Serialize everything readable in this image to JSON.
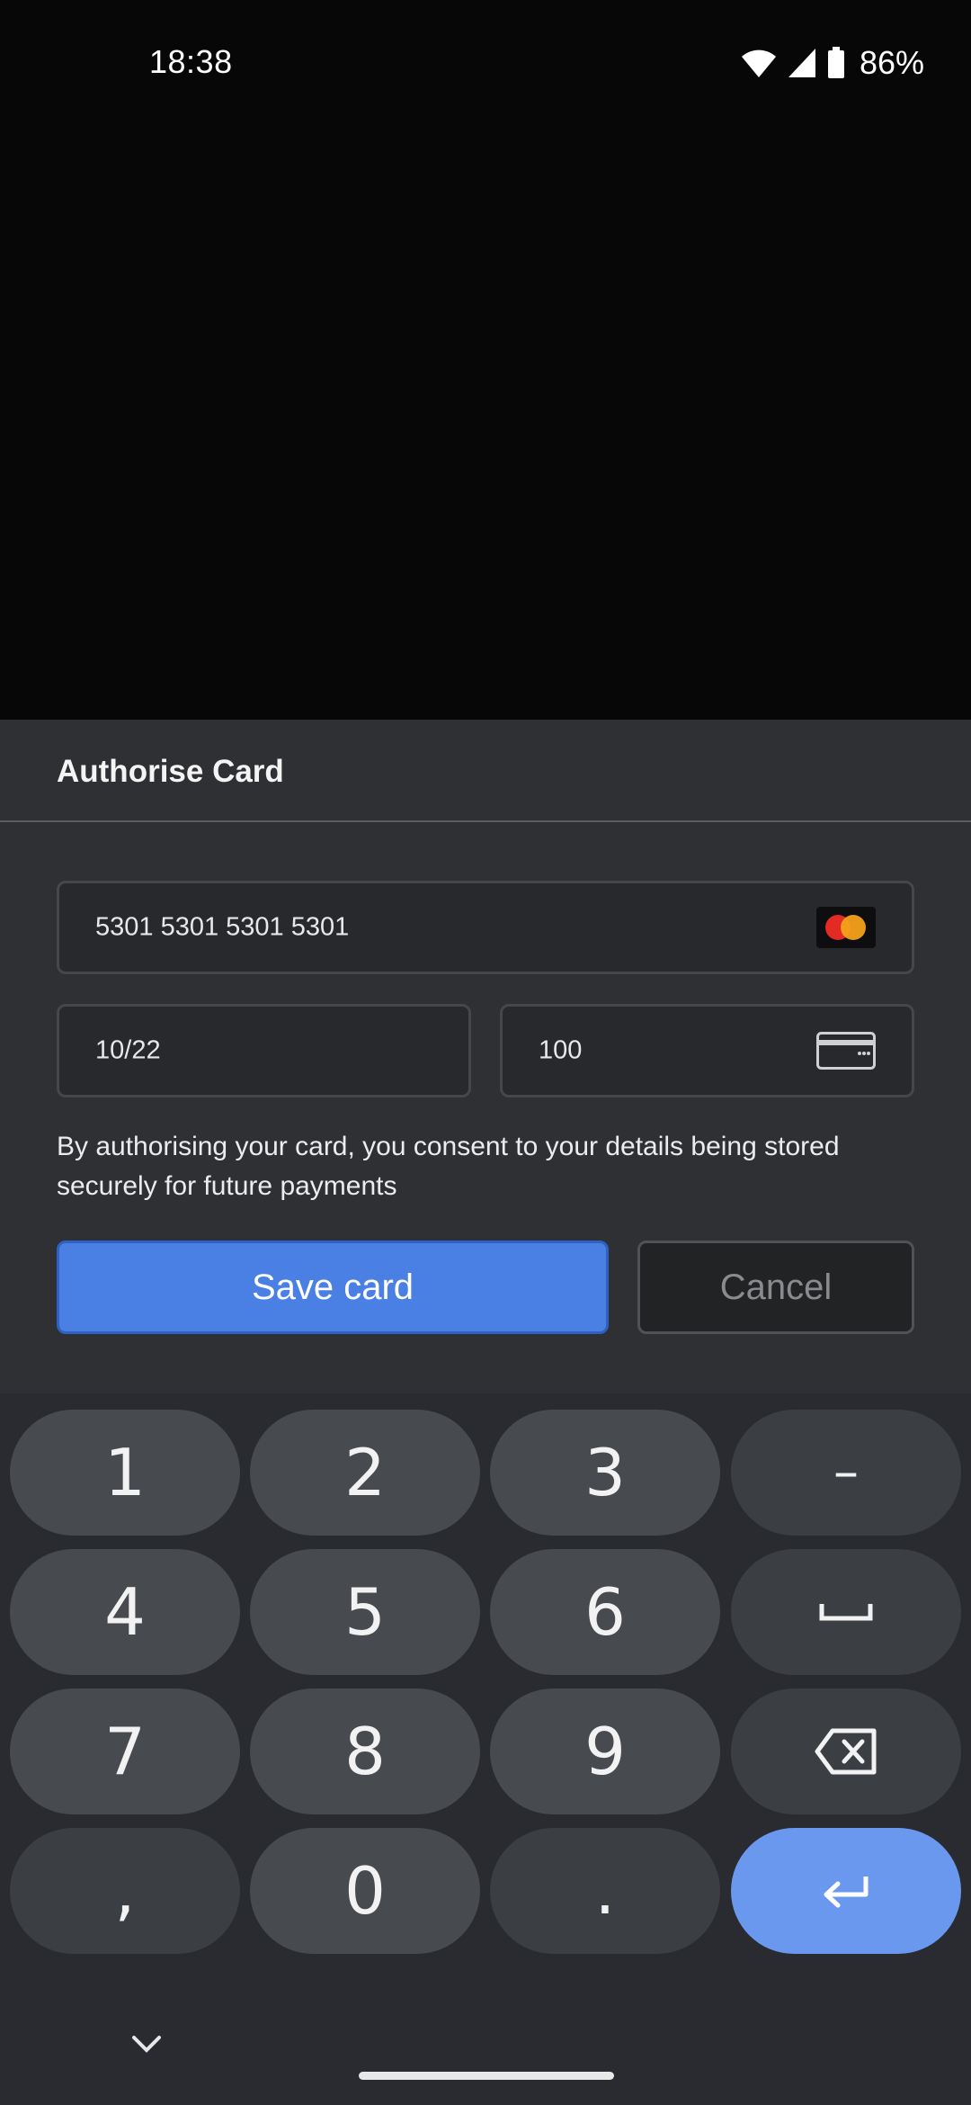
{
  "status_bar": {
    "time": "18:38",
    "battery_percent": "86%",
    "icons": [
      "wifi-icon",
      "signal-icon",
      "battery-icon"
    ]
  },
  "sheet": {
    "title": "Authorise Card",
    "card_number": {
      "value": "5301 5301 5301 5301",
      "brand_icon": "mastercard-icon"
    },
    "expiry": {
      "value": "10/22"
    },
    "cvc": {
      "value": "100",
      "icon": "card-back-icon"
    },
    "consent_text": "By authorising your card, you consent to your details being stored securely for future payments",
    "save_label": "Save card",
    "cancel_label": "Cancel"
  },
  "keyboard": {
    "keys": {
      "k1": "1",
      "k2": "2",
      "k3": "3",
      "dash": "–",
      "k4": "4",
      "k5": "5",
      "k6": "6",
      "k7": "7",
      "k8": "8",
      "k9": "9",
      "comma": ",",
      "k0": "0",
      "period": "."
    },
    "icons": [
      "space-icon",
      "backspace-icon",
      "enter-icon",
      "chevron-down-icon"
    ]
  },
  "colors": {
    "accent": "#4a80e4",
    "enter_key": "#6a98ef",
    "sheet_bg": "#2f3033",
    "keyboard_bg": "#292b30"
  }
}
